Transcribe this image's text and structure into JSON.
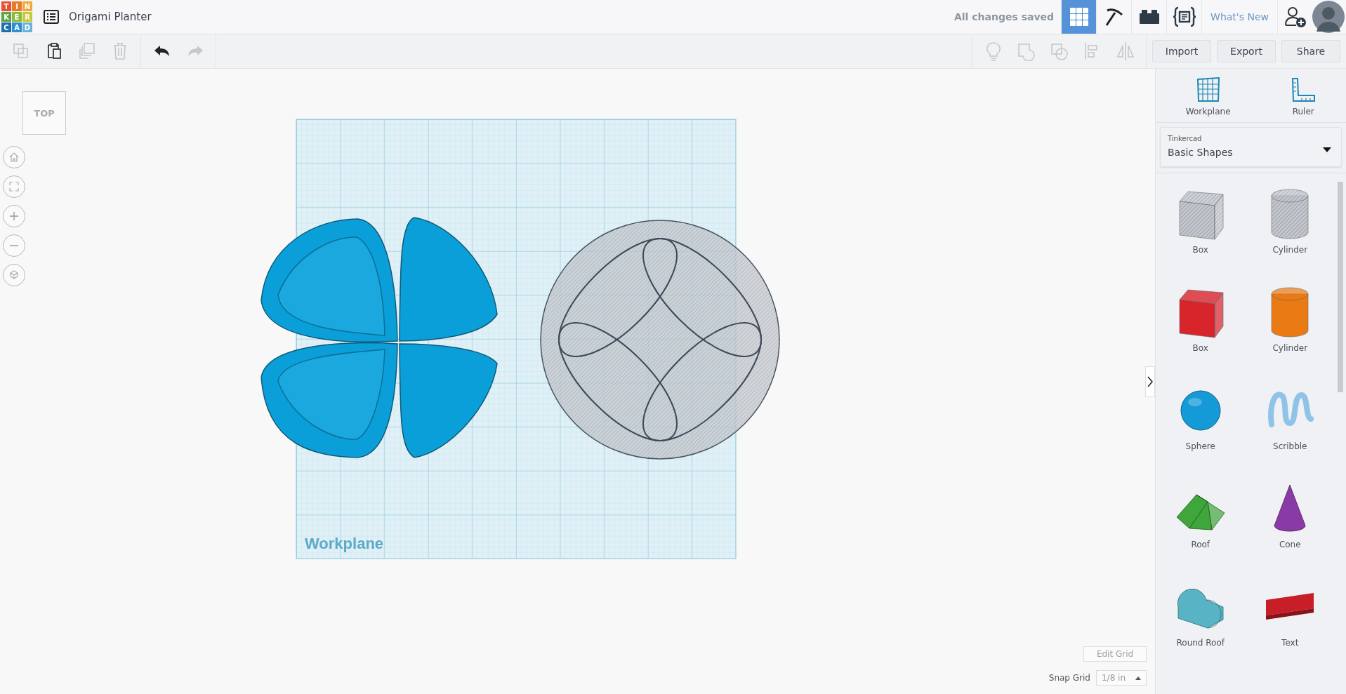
{
  "logo": {
    "letters": [
      {
        "text": "T",
        "color": "#e8502f"
      },
      {
        "text": "I",
        "color": "#ea7a27"
      },
      {
        "text": "N",
        "color": "#f0a83a"
      },
      {
        "text": "K",
        "color": "#5da446"
      },
      {
        "text": "E",
        "color": "#8bbd3c"
      },
      {
        "text": "R",
        "color": "#c9c73a"
      },
      {
        "text": "C",
        "color": "#1e6fae"
      },
      {
        "text": "A",
        "color": "#2d8fcb"
      },
      {
        "text": "D",
        "color": "#6ab4dc"
      }
    ]
  },
  "title": "Origami Planter",
  "save_status": "All changes saved",
  "nav": [
    {
      "kind": "grid",
      "selected": true
    },
    {
      "kind": "pickaxe",
      "selected": false
    },
    {
      "kind": "brick",
      "selected": false
    },
    {
      "kind": "code",
      "selected": false
    }
  ],
  "whats_new": "What's New",
  "edit_tools": [
    {
      "kind": "copy",
      "disabled": true
    },
    {
      "kind": "paste",
      "disabled": false
    },
    {
      "kind": "duplicate",
      "disabled": true
    },
    {
      "kind": "delete",
      "disabled": true
    }
  ],
  "history_tools": [
    {
      "kind": "undo",
      "disabled": false
    },
    {
      "kind": "redo",
      "disabled": true
    }
  ],
  "shape_tools": [
    {
      "kind": "bulb",
      "disabled": true
    },
    {
      "kind": "group",
      "disabled": true
    },
    {
      "kind": "ungroup",
      "disabled": true
    },
    {
      "kind": "align",
      "disabled": true
    },
    {
      "kind": "mirror",
      "disabled": true
    }
  ],
  "actions": [
    "Import",
    "Export",
    "Share"
  ],
  "view_cube": "TOP",
  "canvas": {
    "workplane_label": "Workplane"
  },
  "panel_tools": [
    {
      "kind": "workplane",
      "label": "Workplane"
    },
    {
      "kind": "ruler",
      "label": "Ruler"
    }
  ],
  "library": {
    "provider": "Tinkercad",
    "category": "Basic Shapes"
  },
  "shapes": [
    {
      "kind": "box",
      "hole": true,
      "color": "#c4c8ce",
      "name": "Box"
    },
    {
      "kind": "cylinder",
      "hole": true,
      "color": "#c4c8ce",
      "name": "Cylinder"
    },
    {
      "kind": "box",
      "hole": false,
      "color": "#d8242b",
      "name": "Box"
    },
    {
      "kind": "cylinder",
      "hole": false,
      "color": "#ea7a14",
      "name": "Cylinder"
    },
    {
      "kind": "sphere",
      "color": "#149ad6",
      "name": "Sphere"
    },
    {
      "kind": "scribble",
      "color": "#8fc3e8",
      "name": "Scribble"
    },
    {
      "kind": "roof",
      "color": "#3ea63a",
      "name": "Roof"
    },
    {
      "kind": "cone",
      "color": "#8a3aa6",
      "name": "Cone"
    },
    {
      "kind": "round_roof",
      "color": "#58b4c4",
      "name": "Round Roof"
    },
    {
      "kind": "text",
      "color": "#c81e28",
      "name": "Text"
    }
  ],
  "edit_grid": "Edit Grid",
  "snap_grid": {
    "label": "Snap Grid",
    "value": "1/8 in"
  }
}
